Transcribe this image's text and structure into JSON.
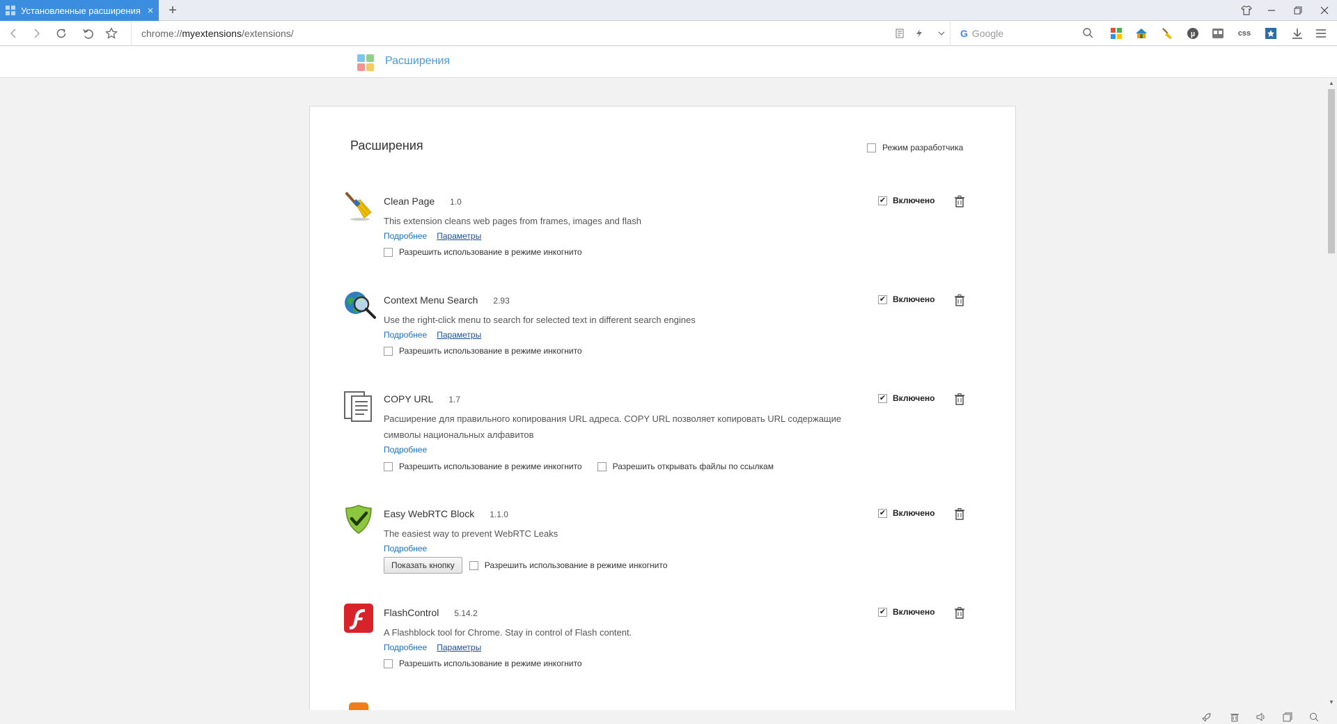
{
  "tab": {
    "title": "Установленные расширения",
    "close": "×",
    "new_tab": "+"
  },
  "address": {
    "scheme": "chrome://",
    "host": "myextensions",
    "path": "/extensions/"
  },
  "search": {
    "engine_letter": "G",
    "placeholder": "Google"
  },
  "toolbar": {
    "css_label": "css"
  },
  "header": {
    "title": "Расширения"
  },
  "panel": {
    "title": "Расширения",
    "developer_mode_label": "Режим разработчика",
    "developer_mode_checked": false
  },
  "extensions": [
    {
      "name": "Clean Page",
      "version": "1.0",
      "description": "This extension cleans web pages from frames, images and flash",
      "details_link": "Подробнее",
      "options_link": "Параметры",
      "incognito_label": "Разрешить использование в режиме инкогнито",
      "enabled_label": "Включено",
      "enabled": true,
      "icon": "broom-icon"
    },
    {
      "name": "Context Menu Search",
      "version": "2.93",
      "description": "Use the right-click menu to search for selected text in different search engines",
      "details_link": "Подробнее",
      "options_link": "Параметры",
      "incognito_label": "Разрешить использование в режиме инкогнито",
      "enabled_label": "Включено",
      "enabled": true,
      "icon": "globe-magnifier-icon"
    },
    {
      "name": "COPY URL",
      "version": "1.7",
      "description": "Расширение для правильного копирования URL адреса. COPY URL позволяет копировать URL содержащие символы национальных алфавитов",
      "details_link": "Подробнее",
      "incognito_label": "Разрешить использование в режиме инкогнито",
      "file_urls_label": "Разрешить открывать файлы по ссылкам",
      "enabled_label": "Включено",
      "enabled": true,
      "icon": "copy-document-icon"
    },
    {
      "name": "Easy WebRTC Block",
      "version": "1.1.0",
      "description": "The easiest way to prevent WebRTC Leaks",
      "details_link": "Подробнее",
      "show_button_label": "Показать кнопку",
      "incognito_label": "Разрешить использование в режиме инкогнито",
      "enabled_label": "Включено",
      "enabled": true,
      "icon": "shield-check-icon"
    },
    {
      "name": "FlashControl",
      "version": "5.14.2",
      "description": "A Flashblock tool for Chrome. Stay in control of Flash content.",
      "details_link": "Подробнее",
      "options_link": "Параметры",
      "incognito_label": "Разрешить использование в режиме инкогнито",
      "enabled_label": "Включено",
      "enabled": true,
      "icon": "flash-icon"
    }
  ],
  "colors": {
    "tab_active": "#3b8de0",
    "link": "#1a6fc4",
    "header_title": "#4a9ad9"
  }
}
